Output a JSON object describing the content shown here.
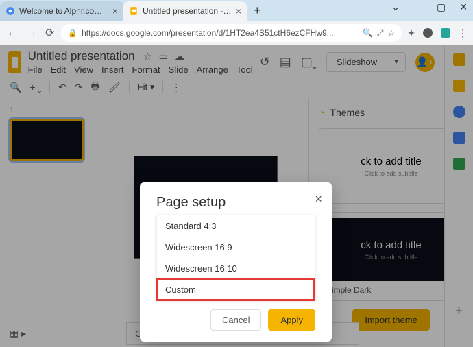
{
  "browser": {
    "tabs": [
      {
        "title": "Welcome to Alphr.com - Google"
      },
      {
        "title": "Untitled presentation - Google S"
      }
    ],
    "url": "https://docs.google.com/presentation/d/1HT2ea4S51ctH6ezCFHw9..."
  },
  "header": {
    "doc_title": "Untitled presentation",
    "menus": [
      "File",
      "Edit",
      "View",
      "Insert",
      "Format",
      "Slide",
      "Arrange",
      "Tool"
    ],
    "slideshow_label": "Slideshow"
  },
  "toolbar": {
    "zoom_label": "Fit"
  },
  "themes": {
    "title": "Themes",
    "cards": [
      {
        "title": "ck to add title",
        "subtitle": "Click to add subtitle",
        "label": ""
      },
      {
        "title": "ck to add title",
        "subtitle": "Click to add subtitle",
        "label": "Simple Dark"
      }
    ],
    "import_label": "Import theme"
  },
  "speaker_notes_placeholder": "Click to add speaker notes",
  "modal": {
    "title": "Page setup",
    "options": [
      "Standard 4:3",
      "Widescreen 16:9",
      "Widescreen 16:10",
      "Custom"
    ],
    "cancel_label": "Cancel",
    "apply_label": "Apply"
  },
  "filmstrip": {
    "slide_number": "1"
  }
}
